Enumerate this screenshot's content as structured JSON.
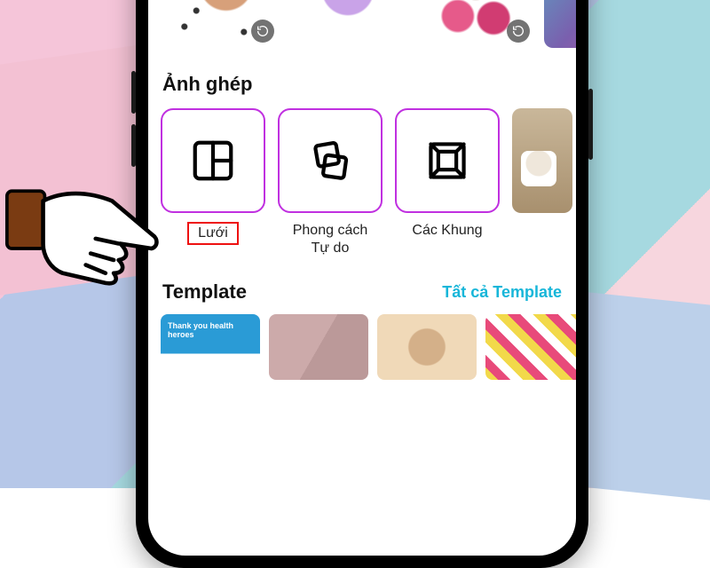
{
  "sections": {
    "collage_title": "Ảnh ghép",
    "template_title": "Template",
    "template_all": "Tất cả Template"
  },
  "collage_options": [
    {
      "key": "grid",
      "label": "Lưới"
    },
    {
      "key": "freeform",
      "label": "Phong cách\nTự do"
    },
    {
      "key": "frames",
      "label": "Các Khung"
    }
  ],
  "templates": {
    "banner_text": "Thank you health heroes"
  },
  "highlighted_option": "grid"
}
